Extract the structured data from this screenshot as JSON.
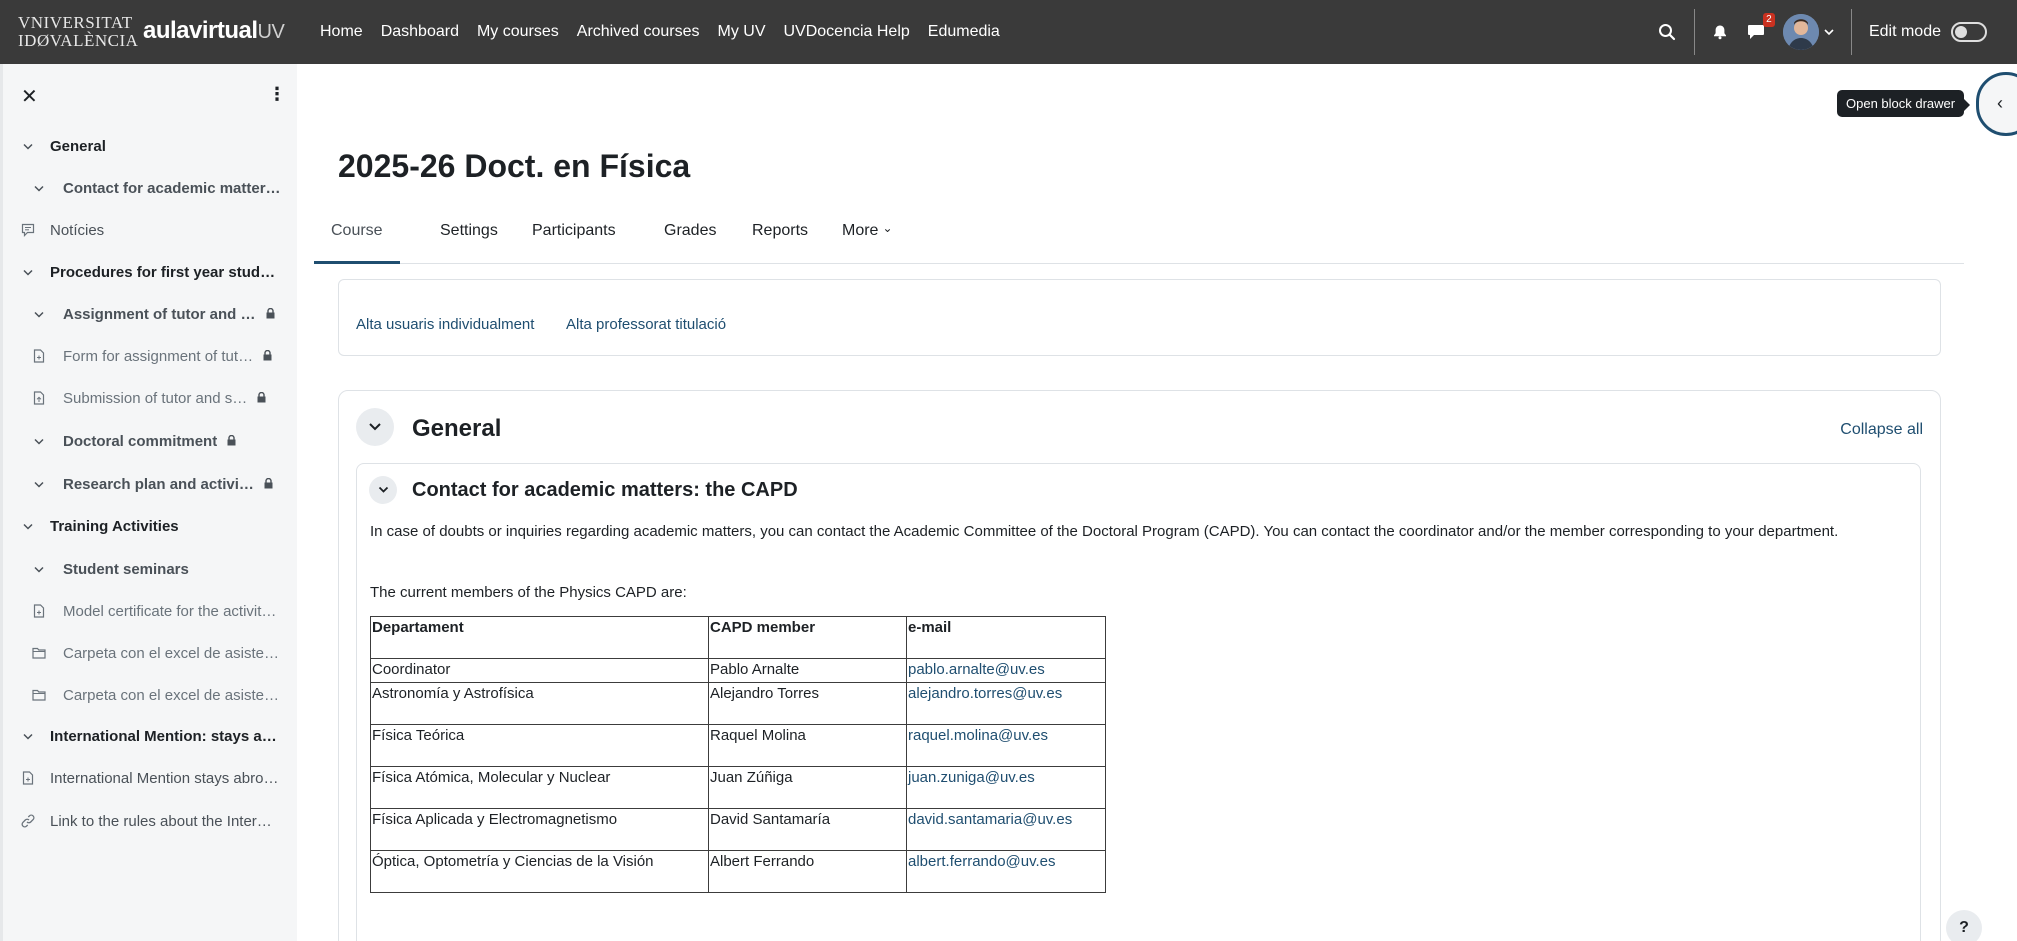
{
  "navbar": {
    "uv_logo_line1": "VNIVERSITAT",
    "uv_logo_line2": "IDØVALÈNCIA",
    "aula_logo_main": "aulavirtual",
    "aula_logo_suffix": "UV",
    "links": [
      "Home",
      "Dashboard",
      "My courses",
      "Archived courses",
      "My UV",
      "UVDocencia Help",
      "Edumedia"
    ],
    "messages_badge": "2",
    "edit_mode_label": "Edit mode"
  },
  "drawer": {
    "items": [
      {
        "label": "General",
        "kind": "sec",
        "icon": "chevron-down-icon"
      },
      {
        "label": "Contact for academic matter…",
        "kind": "sub",
        "icon": "chevron-down-icon"
      },
      {
        "label": "Notícies",
        "kind": "top",
        "icon": "forum-icon"
      },
      {
        "label": "Procedures for first year stud…",
        "kind": "sec",
        "icon": "chevron-down-icon"
      },
      {
        "label": "Assignment of tutor and …",
        "kind": "sub",
        "icon": "chevron-down-icon",
        "locked": true
      },
      {
        "label": "Form for assignment of tut…",
        "kind": "mod",
        "icon": "file-icon",
        "locked": true
      },
      {
        "label": "Submission of tutor and s…",
        "kind": "mod",
        "icon": "upload-icon",
        "locked": true
      },
      {
        "label": "Doctoral commitment",
        "kind": "sub",
        "icon": "chevron-down-icon",
        "locked": true
      },
      {
        "label": "Research plan and activi…",
        "kind": "sub",
        "icon": "chevron-down-icon",
        "locked": true
      },
      {
        "label": "Training Activities",
        "kind": "sec",
        "icon": "chevron-down-icon"
      },
      {
        "label": "Student seminars",
        "kind": "sub",
        "icon": "chevron-down-icon"
      },
      {
        "label": "Model certificate for the activit…",
        "kind": "mod",
        "icon": "file-icon"
      },
      {
        "label": "Carpeta con el excel de asiste…",
        "kind": "mod",
        "icon": "folder-icon"
      },
      {
        "label": "Carpeta con el excel de asiste…",
        "kind": "mod",
        "icon": "folder-icon"
      },
      {
        "label": "International Mention: stays a…",
        "kind": "sec",
        "icon": "chevron-down-icon"
      },
      {
        "label": "International Mention stays abro…",
        "kind": "top",
        "icon": "file-icon"
      },
      {
        "label": "Link to the rules about the Inter…",
        "kind": "top",
        "icon": "link-icon"
      }
    ]
  },
  "tooltip": "Open block drawer",
  "page_title": "2025-26 Doct. en Física",
  "tabs": [
    "Course",
    "Settings",
    "Participants",
    "Grades",
    "Reports",
    "More"
  ],
  "secondary_links": [
    "Alta usuaris individualment",
    "Alta professorat titulació"
  ],
  "section": {
    "title": "General",
    "collapse_all": "Collapse all",
    "subsection_title": "Contact for academic matters: the CAPD",
    "paragraph1": "In case of doubts or inquiries regarding academic matters, you can contact the Academic Committee of the Doctoral Program (CAPD). You can contact the coordinator and/or the member corresponding to your department.",
    "paragraph2": "The current members of the Physics CAPD are:",
    "table": {
      "headers": [
        "Departament",
        "CAPD member",
        "e-mail"
      ],
      "rows": [
        [
          "Coordinator",
          "Pablo Arnalte",
          "pablo.arnalte@uv.es"
        ],
        [
          "Astronomía y Astrofísica",
          "Alejandro Torres",
          "alejandro.torres@uv.es"
        ],
        [
          "Física Teórica",
          "Raquel Molina",
          "raquel.molina@uv.es"
        ],
        [
          "Física Atómica, Molecular y Nuclear",
          "Juan Zúñiga",
          "juan.zuniga@uv.es"
        ],
        [
          "Física Aplicada y Electromagnetismo",
          "David Santamaría",
          "david.santamaria@uv.es"
        ],
        [
          "Óptica, Optometría y Ciencias de la Visión",
          "Albert Ferrando",
          "albert.ferrando@uv.es"
        ]
      ]
    }
  },
  "help_button": "?"
}
